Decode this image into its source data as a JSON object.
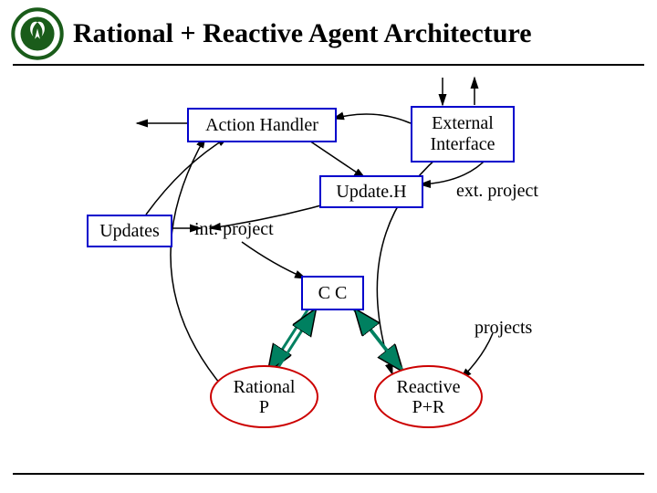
{
  "title": "Rational + Reactive Agent Architecture",
  "boxes": {
    "action_handler": "Action Handler",
    "external_interface": "External\nInterface",
    "update_h": "Update.H",
    "updates": "Updates",
    "cc": "C C"
  },
  "ellipses": {
    "rational_p": "Rational\nP",
    "reactive_pr": "Reactive\nP+R"
  },
  "labels": {
    "int_project": "int. project",
    "ext_project": "ext. project",
    "projects": "projects"
  }
}
